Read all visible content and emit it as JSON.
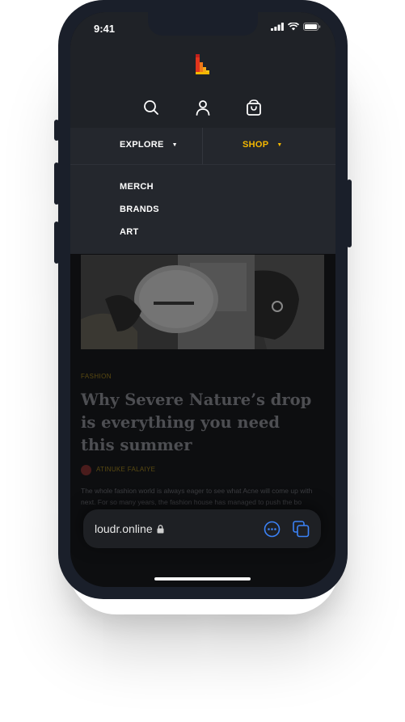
{
  "status": {
    "time": "9:41"
  },
  "header": {
    "icons": {
      "search": "search-icon",
      "account": "user-icon",
      "bag": "shopping-bag-icon"
    },
    "logo": "loudr-logo"
  },
  "menu": {
    "explore_label": "EXPLORE",
    "shop_label": "SHOP",
    "submenu": [
      "MERCH",
      "BRANDS",
      "ART"
    ]
  },
  "article": {
    "category": "FASHION",
    "title": "Why Severe Nature’s drop is everything you need this summer",
    "author": "ATINUKE FALAIYE",
    "excerpt": "The whole fashion world is always eager to see what Acne will come up with next. For so many years, the fashion house has managed to push the bo"
  },
  "browser": {
    "url": "loudr.online"
  },
  "colors": {
    "accent": "#f5b800",
    "bg": "#0d0e10",
    "header": "#1f2227"
  }
}
